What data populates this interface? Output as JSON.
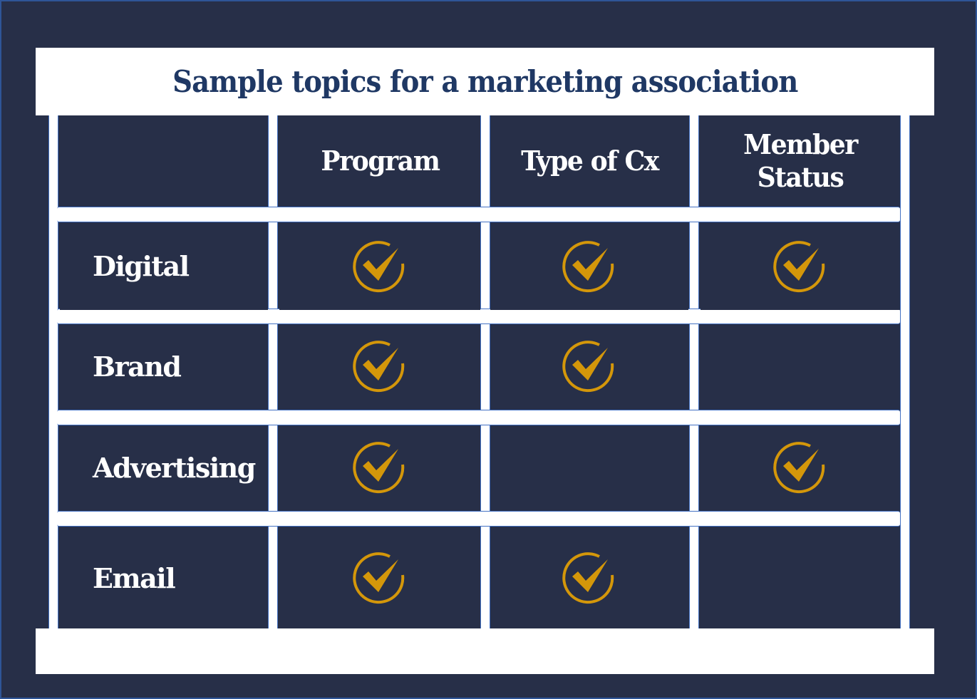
{
  "title": "Sample topics for a marketing association",
  "colors": {
    "background": "#272f48",
    "title_text": "#1f3864",
    "grid_lines": "#ffffff",
    "grid_outline": "#4472c4",
    "check": "#d4970a",
    "cell_text": "#ffffff"
  },
  "columns": [
    "",
    "Program",
    "Type of Cx",
    "Member Status"
  ],
  "rows": [
    {
      "label": "Digital",
      "checks": [
        true,
        true,
        true
      ]
    },
    {
      "label": "Brand",
      "checks": [
        true,
        true,
        false
      ]
    },
    {
      "label": "Advertising",
      "checks": [
        true,
        false,
        true
      ]
    },
    {
      "label": "Email",
      "checks": [
        true,
        true,
        false
      ]
    }
  ],
  "icons": {
    "check": "check-circle-icon"
  }
}
